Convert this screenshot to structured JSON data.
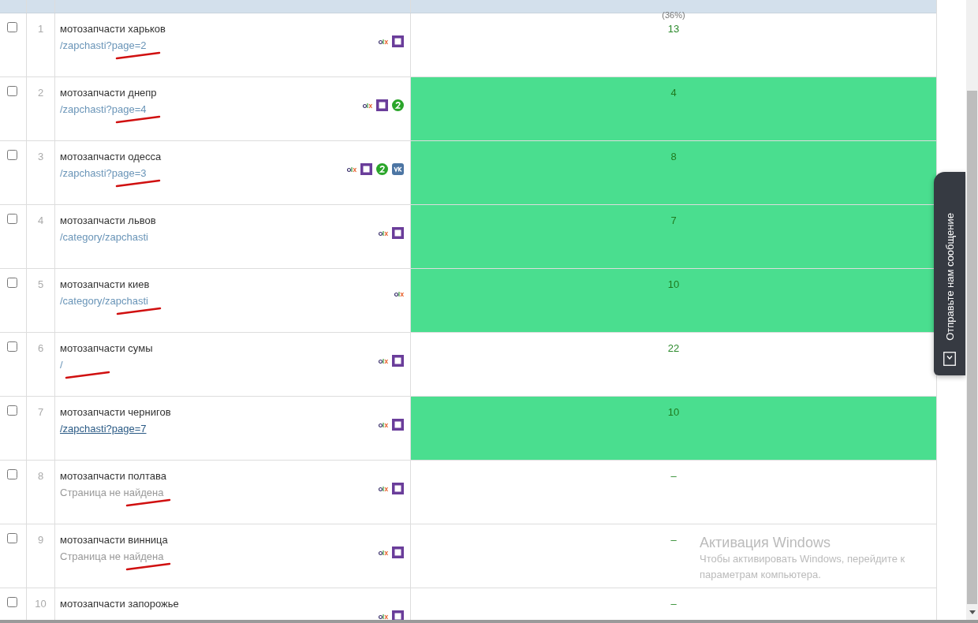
{
  "table": {
    "header": {
      "column_4_note": "(36%)"
    },
    "rows": [
      {
        "number": "1",
        "checked": false,
        "query": "мотозапчасти харьков",
        "url": {
          "kind": "link",
          "text": "/zapchasti?page=2",
          "underlined": false,
          "annotated": true
        },
        "icons": [
          {
            "kind": "olx"
          },
          {
            "kind": "square"
          }
        ],
        "value": "13",
        "highlighted": false
      },
      {
        "number": "2",
        "checked": false,
        "query": "мотозапчасти днепр",
        "url": {
          "kind": "link",
          "text": "/zapchasti?page=4",
          "underlined": false,
          "annotated": true
        },
        "icons": [
          {
            "kind": "olx"
          },
          {
            "kind": "square"
          },
          {
            "kind": "badge"
          }
        ],
        "value": "4",
        "highlighted": true
      },
      {
        "number": "3",
        "checked": false,
        "query": "мотозапчасти одесса",
        "url": {
          "kind": "link",
          "text": "/zapchasti?page=3",
          "underlined": false,
          "annotated": true
        },
        "icons": [
          {
            "kind": "olx"
          },
          {
            "kind": "square"
          },
          {
            "kind": "badge"
          },
          {
            "kind": "vk"
          }
        ],
        "value": "8",
        "highlighted": true
      },
      {
        "number": "4",
        "checked": false,
        "query": "мотозапчасти львов",
        "url": {
          "kind": "link",
          "text": "/category/zapchasti",
          "underlined": false,
          "annotated": false
        },
        "icons": [
          {
            "kind": "olx"
          },
          {
            "kind": "square"
          }
        ],
        "value": "7",
        "highlighted": true
      },
      {
        "number": "5",
        "checked": false,
        "query": "мотозапчасти киев",
        "url": {
          "kind": "link",
          "text": "/category/zapchasti",
          "underlined": false,
          "annotated": true
        },
        "icons": [
          {
            "kind": "olx"
          }
        ],
        "value": "10",
        "highlighted": true
      },
      {
        "number": "6",
        "checked": false,
        "query": "мотозапчасти сумы",
        "url": {
          "kind": "link",
          "text": "/",
          "underlined": false,
          "annotated": true
        },
        "icons": [
          {
            "kind": "olx"
          },
          {
            "kind": "square"
          }
        ],
        "value": "22",
        "highlighted": false
      },
      {
        "number": "7",
        "checked": false,
        "query": "мотозапчасти чернигов",
        "url": {
          "kind": "link",
          "text": "/zapchasti?page=7",
          "underlined": true,
          "annotated": false
        },
        "icons": [
          {
            "kind": "olx"
          },
          {
            "kind": "square"
          }
        ],
        "value": "10",
        "highlighted": true
      },
      {
        "number": "8",
        "checked": false,
        "query": "мотозапчасти полтава",
        "url": {
          "kind": "not_found",
          "text": "Страница не найдена",
          "underlined": false,
          "annotated": true
        },
        "icons": [
          {
            "kind": "olx"
          },
          {
            "kind": "square"
          }
        ],
        "value": "–",
        "highlighted": false
      },
      {
        "number": "9",
        "checked": false,
        "query": "мотозапчасти винница",
        "url": {
          "kind": "not_found",
          "text": "Страница не найдена",
          "underlined": false,
          "annotated": true
        },
        "icons": [
          {
            "kind": "olx"
          },
          {
            "kind": "square"
          }
        ],
        "value": "–",
        "highlighted": false
      },
      {
        "number": "10",
        "checked": false,
        "query": "мотозапчасти запорожье",
        "icons": [
          {
            "kind": "olx"
          },
          {
            "kind": "square"
          }
        ],
        "value": "–",
        "highlighted": false
      }
    ]
  },
  "feedback_tab": {
    "label": "Отправьте нам сообщение"
  },
  "windows_notice": {
    "title": "Активация Windows",
    "text": "Чтобы активировать Windows, перейдите к параметрам компьютера."
  }
}
